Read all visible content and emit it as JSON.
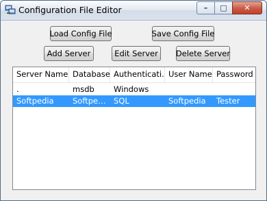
{
  "window": {
    "title": "Configuration File Editor",
    "minimize": "–",
    "maximize": "□",
    "close": "✕"
  },
  "buttons": {
    "load_config": "Load Config File",
    "save_config": "Save Config File",
    "add_server": "Add Server",
    "edit_server": "Edit Server",
    "delete_server": "Delete Server"
  },
  "list": {
    "columns": [
      "Server Name",
      "Database",
      "Authenticati...",
      "User Name",
      "Password"
    ],
    "rows": [
      {
        "server": ".",
        "database": "msdb",
        "auth": "Windows",
        "user": "",
        "password": "",
        "selected": false
      },
      {
        "server": "Softpedia",
        "database": "Softpedi...",
        "auth": "SQL",
        "user": "Softpedia",
        "password": "Tester",
        "selected": true
      }
    ]
  },
  "colors": {
    "selection": "#3399ff",
    "window_bg": "#f0f0f0"
  }
}
